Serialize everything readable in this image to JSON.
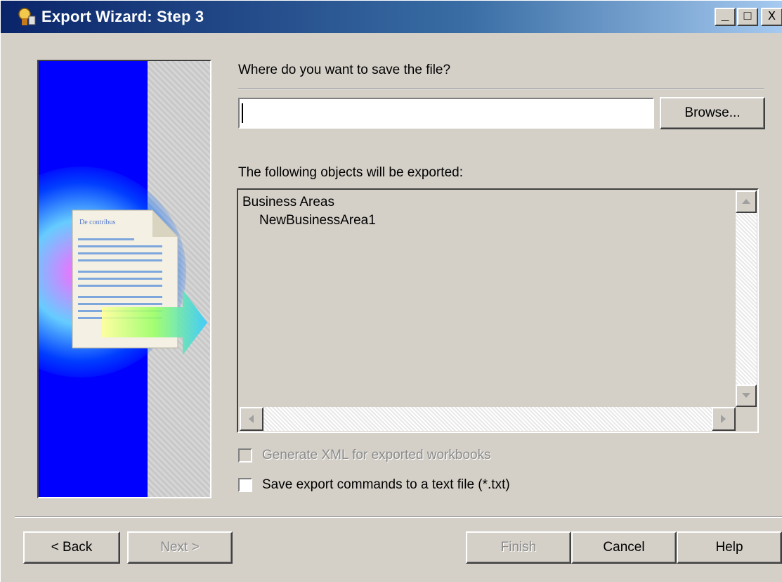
{
  "window": {
    "title": "Export Wizard: Step 3",
    "controls": {
      "minimize": "_",
      "maximize": "□",
      "close": "X"
    }
  },
  "save": {
    "prompt": "Where do you want to save the file?",
    "path_value": "",
    "browse_label": "Browse..."
  },
  "objects": {
    "label": "The following objects will be exported:",
    "items": [
      "Business Areas",
      "NewBusinessArea1"
    ]
  },
  "options": {
    "generate_xml": {
      "label": "Generate XML for exported workbooks",
      "checked": false,
      "enabled": false
    },
    "save_commands": {
      "label": "Save export commands to a text file (*.txt)",
      "checked": false,
      "enabled": true
    }
  },
  "buttons": {
    "back": "< Back",
    "next": "Next >",
    "finish": "Finish",
    "cancel": "Cancel",
    "help": "Help"
  },
  "banner": {
    "doc_heading": "De contribus"
  },
  "colors": {
    "title_start": "#0a246a",
    "title_end": "#a6caf0",
    "face": "#d4d0c8",
    "banner_blue": "#0000ff"
  }
}
